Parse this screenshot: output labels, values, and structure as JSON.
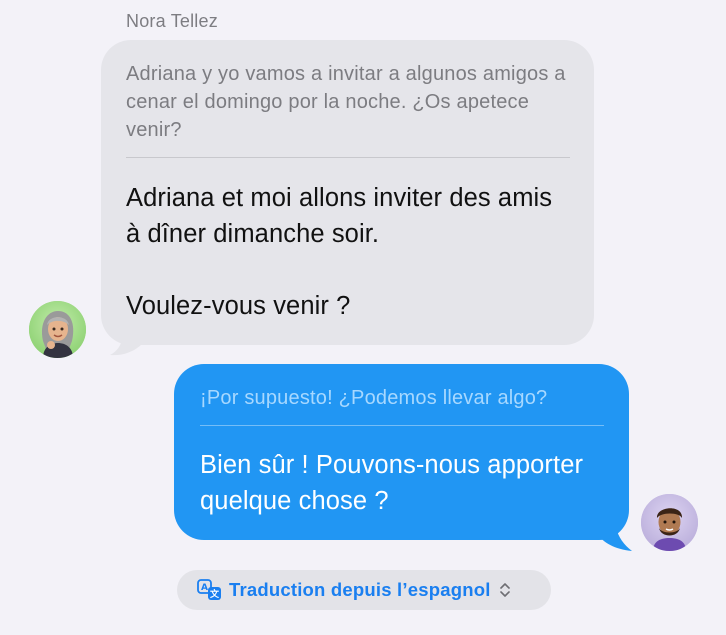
{
  "conversation": {
    "incoming": {
      "sender_name": "Nora Tellez",
      "original_text": "Adriana y yo vamos a invitar a algunos amigos a cenar el domingo por la noche. ¿Os apetece venir?",
      "translated_line1": "Adriana et moi allons inviter des amis à dîner dimanche soir.",
      "translated_line2": "Voulez-vous venir ?",
      "bubble_color": "#e5e5ea",
      "avatar_icon": "memoji-woman-gray-hair-icon"
    },
    "outgoing": {
      "original_text": "¡Por supuesto! ¿Podemos llevar algo?",
      "translated_text": "Bien sûr ! Pouvons-nous apporter quelque chose ?",
      "bubble_color": "#2196f3",
      "avatar_icon": "memoji-man-icon"
    }
  },
  "translation_bar": {
    "label": "Traduction depuis l’espagnol",
    "icon": "translate-icon",
    "chevron_icon": "chevron-up-down-icon",
    "accent_color": "#1a7ff0"
  }
}
